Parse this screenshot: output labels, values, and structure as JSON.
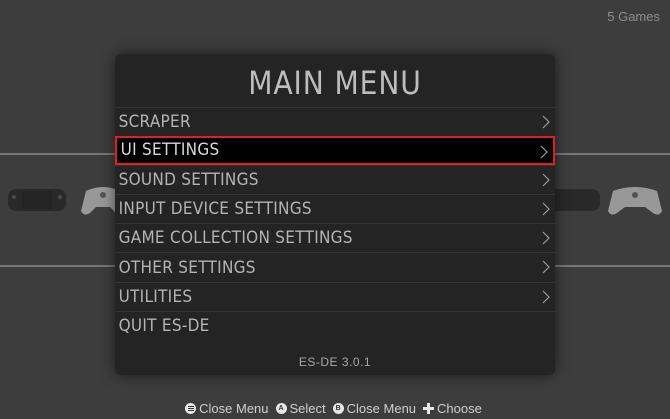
{
  "header": {
    "game_count": "5 Games"
  },
  "menu": {
    "title": "MAIN MENU",
    "items": [
      {
        "label": "SCRAPER",
        "has_submenu": true
      },
      {
        "label": "UI SETTINGS",
        "has_submenu": true,
        "selected": true
      },
      {
        "label": "SOUND SETTINGS",
        "has_submenu": true
      },
      {
        "label": "INPUT DEVICE SETTINGS",
        "has_submenu": true
      },
      {
        "label": "GAME COLLECTION SETTINGS",
        "has_submenu": true
      },
      {
        "label": "OTHER SETTINGS",
        "has_submenu": true
      },
      {
        "label": "UTILITIES",
        "has_submenu": true
      },
      {
        "label": "QUIT ES-DE",
        "has_submenu": false
      }
    ],
    "version": "ES-DE  3.0.1"
  },
  "help_bar": [
    {
      "icon": "menu-button-icon",
      "label": "Close Menu"
    },
    {
      "icon": "a-button-icon",
      "glyph": "A",
      "label": "Select"
    },
    {
      "icon": "b-button-icon",
      "glyph": "B",
      "label": "Close Menu"
    },
    {
      "icon": "dpad-icon",
      "label": "Choose"
    }
  ],
  "colors": {
    "selection_border": "#e21f1f",
    "menu_bg": "#242424",
    "background": "#3d3d3d"
  }
}
